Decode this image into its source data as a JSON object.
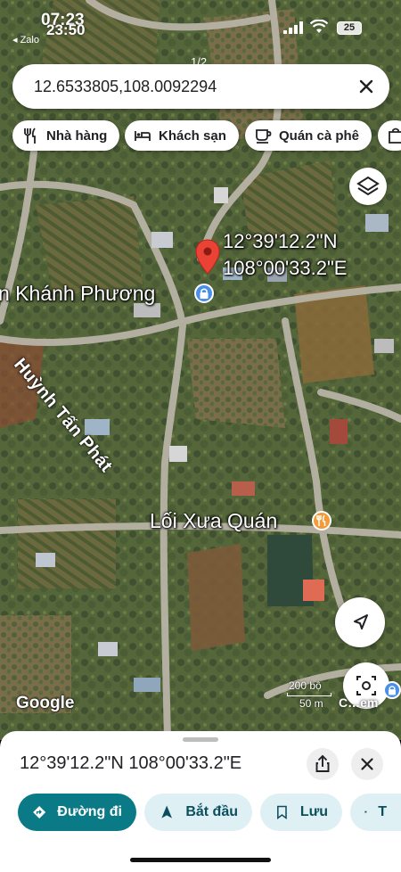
{
  "status_bar": {
    "time": "07:23",
    "time_overlay": "23:50",
    "back_app": "◂ Zalo",
    "battery": "25",
    "page_indicator": "1/2"
  },
  "search": {
    "query": "12.6533805,108.0092294"
  },
  "chips": [
    {
      "label": "Nhà hàng",
      "icon": "fork-knife-icon"
    },
    {
      "label": "Khách sạn",
      "icon": "bed-icon"
    },
    {
      "label": "Quán cà phê",
      "icon": "coffee-cup-icon"
    }
  ],
  "map": {
    "pin_lat": "12°39'12.2\"N",
    "pin_lng": "108°00'33.2\"E",
    "place_label": "n Khánh Phương",
    "street_label": "Huỳnh Tấn Phát",
    "poi_label": "Lối Xưa Quán",
    "logo": "Google",
    "scale_top": "200 bộ",
    "scale_bottom": "50 m",
    "lens_label": "C…em",
    "colors": {
      "pin": "#ea4335",
      "poi_orange": "#f29b38",
      "poi_blue": "#4a8fe8"
    }
  },
  "sheet": {
    "title": "12°39'12.2\"N 108°00'33.2\"E",
    "actions": [
      {
        "label": "Đường đi",
        "icon": "directions-icon"
      },
      {
        "label": "Bắt đầu",
        "icon": "navigation-arrow-icon"
      },
      {
        "label": "Lưu",
        "icon": "bookmark-icon"
      },
      {
        "label": "T",
        "icon": "flag-icon"
      }
    ],
    "accent": "#0b7a87"
  }
}
